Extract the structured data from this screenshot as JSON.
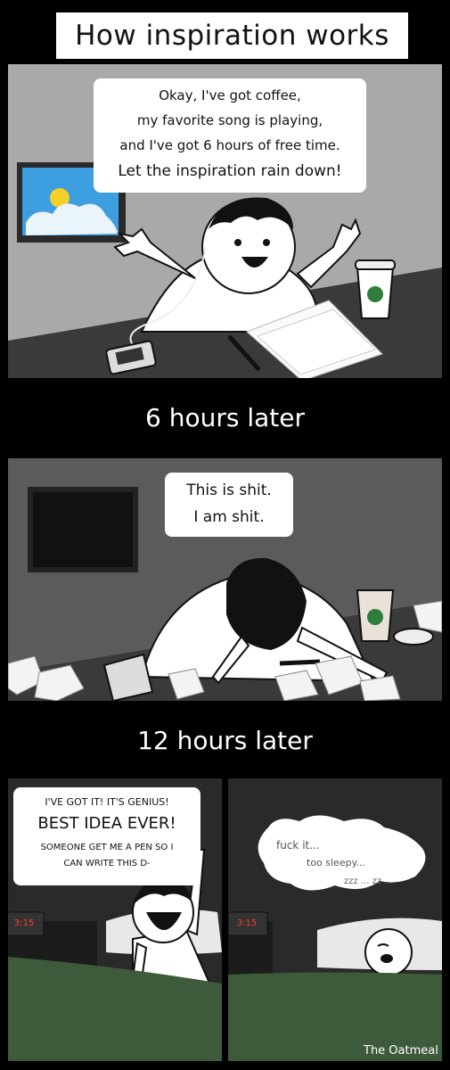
{
  "title": "How inspiration works",
  "captions": {
    "six_hours": "6 hours later",
    "twelve_hours": "12 hours later"
  },
  "panel1": {
    "speech": [
      "Okay, I've got coffee,",
      "my favorite song is playing,",
      "and I've got 6 hours of free time.",
      "Let the inspiration rain down!"
    ]
  },
  "panel2": {
    "speech": [
      "This is shit.",
      "I am shit."
    ]
  },
  "panel3": {
    "speech_line1": "I'VE GOT IT!  IT'S GENIUS!",
    "speech_line2": "BEST IDEA EVER!",
    "speech_line3": "SOMEONE GET ME A PEN SO I",
    "speech_line4": "CAN WRITE THIS D-",
    "clock": "3:15"
  },
  "panel4": {
    "thought": [
      "fuck it...",
      "too sleepy...",
      "zzz ... zz ..."
    ],
    "clock": "3:15"
  },
  "credit": "The Oatmeal",
  "colors": {
    "wall_gray": "#9a9a9a",
    "desk": "#3a3a3a",
    "blanket": "#3d5a3a",
    "coffee_green": "#2f7d3b"
  }
}
